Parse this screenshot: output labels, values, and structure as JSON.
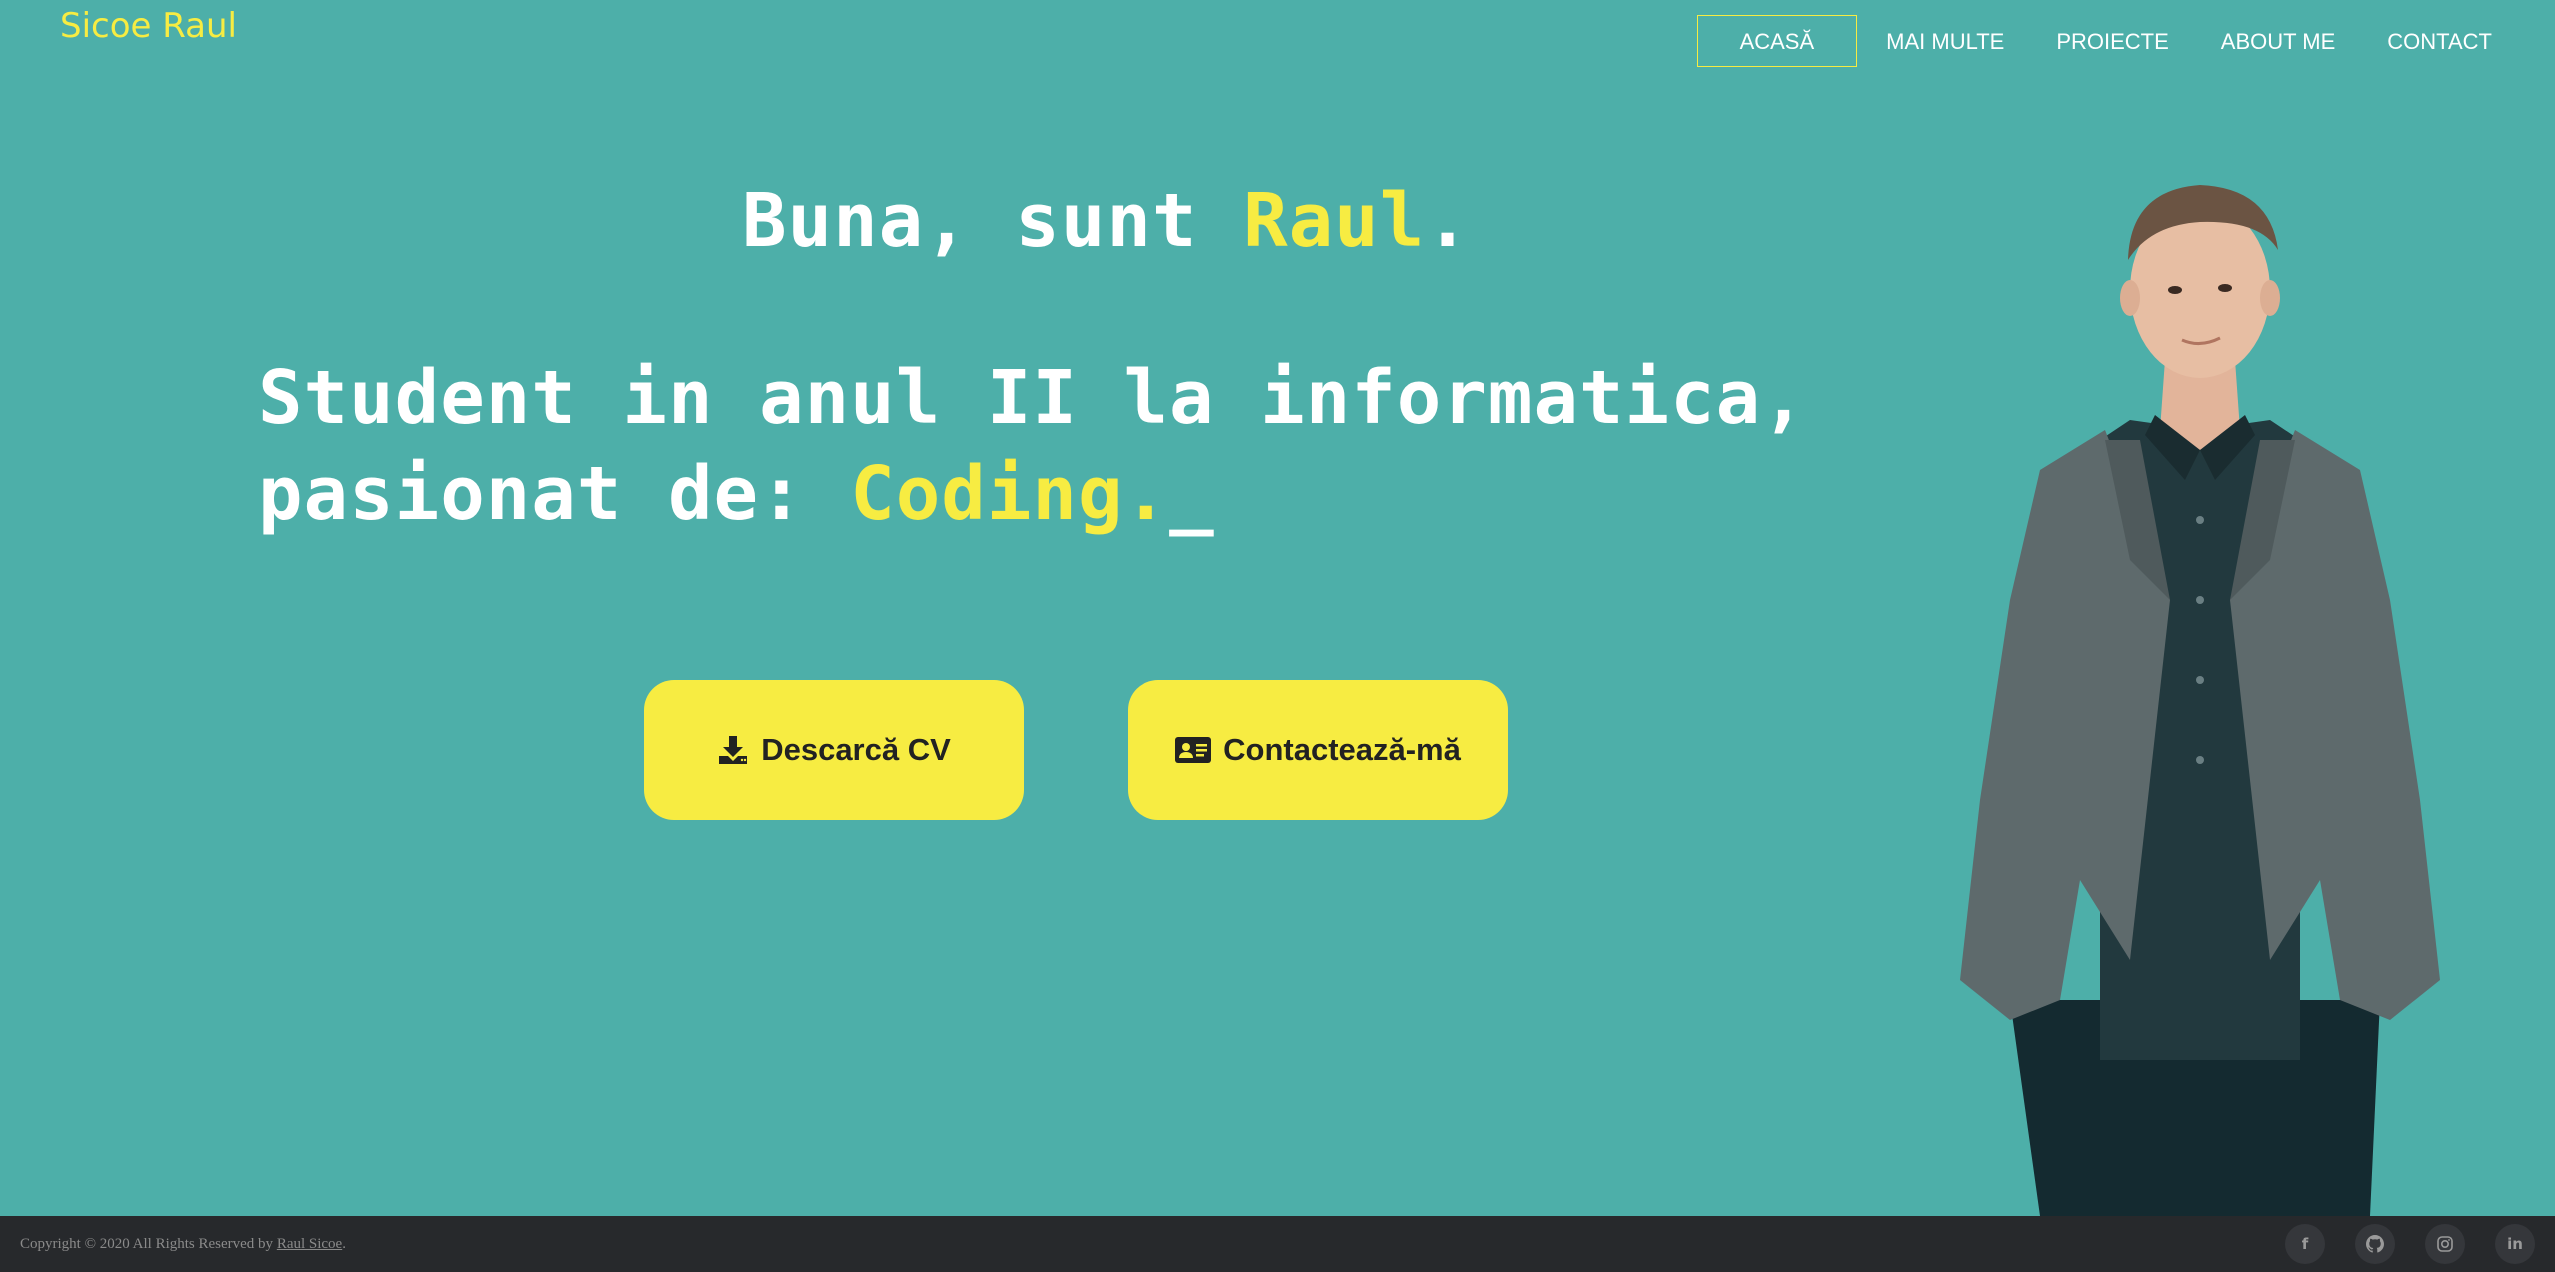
{
  "brand": "Sicoe Raul",
  "nav": [
    {
      "label": "ACASĂ"
    },
    {
      "label": "MAI MULTE"
    },
    {
      "label": "PROIECTE"
    },
    {
      "label": "ABOUT ME"
    },
    {
      "label": "CONTACT"
    }
  ],
  "hero": {
    "greeting_prefix": "Buna, sunt ",
    "greeting_name": "Raul",
    "greeting_suffix": ".",
    "line2": "Student in anul II la informatica,",
    "line3_prefix": "pasionat de: ",
    "line3_highlight": "Coding.",
    "cursor": "_"
  },
  "buttons": {
    "cv_label": "Descarcă CV",
    "contact_label": "Contactează-mă"
  },
  "footer": {
    "copyright_text": "Copyright © 2020 All Rights Reserved by ",
    "copyright_name": "Raul Sicoe",
    "copyright_end": "."
  },
  "socials": [
    {
      "icon": "facebook-icon",
      "glyph": "f"
    },
    {
      "icon": "github-icon",
      "glyph": ""
    },
    {
      "icon": "instagram-icon",
      "glyph": ""
    },
    {
      "icon": "linkedin-icon",
      "glyph": "in"
    }
  ],
  "colors": {
    "background": "#4dafa9",
    "accent": "#f7ec42",
    "footer": "#27292c"
  }
}
